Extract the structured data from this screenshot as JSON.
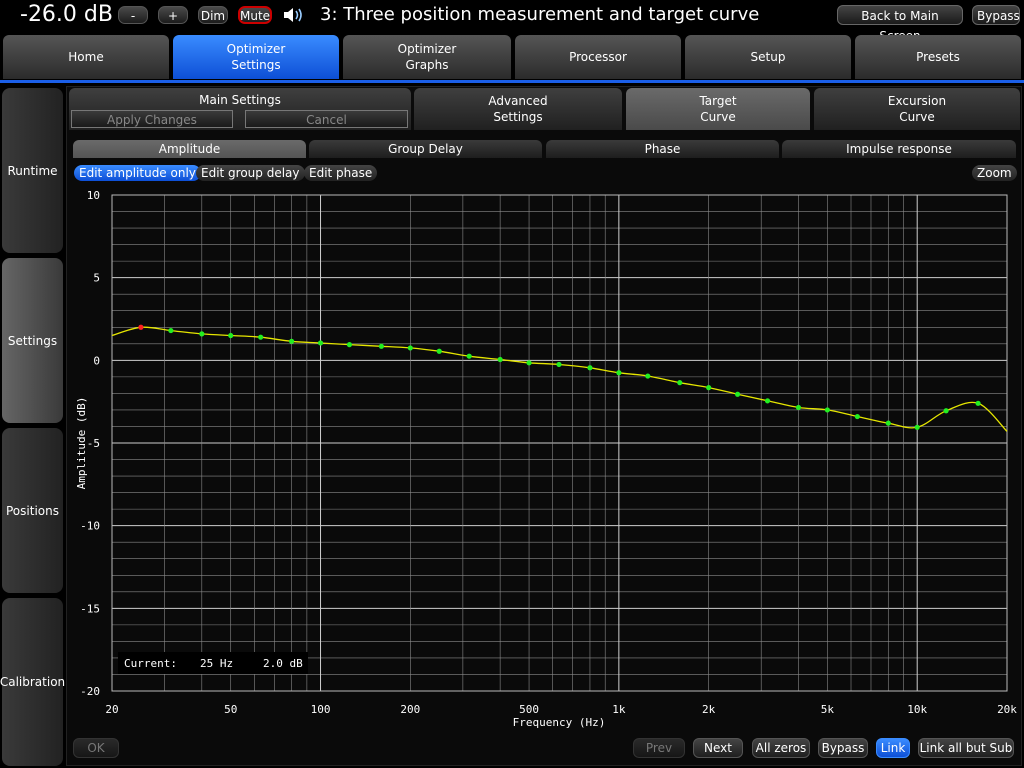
{
  "topbar": {
    "volume": "-26.0 dB",
    "minus": "-",
    "plus": "+",
    "dim": "Dim",
    "mute": "Mute",
    "title": "3: Three position measurement and target curve",
    "back": "Back to Main Screen",
    "bypass": "Bypass"
  },
  "main_tabs": [
    "Home",
    "Optimizer\nSettings",
    "Optimizer\nGraphs",
    "Processor",
    "Setup",
    "Presets"
  ],
  "side_tabs": [
    "Runtime",
    "Settings",
    "Positions",
    "Calibration"
  ],
  "sub_tabs": {
    "main_settings": "Main Settings",
    "apply": "Apply Changes",
    "cancel": "Cancel",
    "advanced": "Advanced\nSettings",
    "target": "Target\nCurve",
    "excursion": "Excursion\nCurve"
  },
  "graph_tabs": [
    "Amplitude",
    "Group Delay",
    "Phase",
    "Impulse response"
  ],
  "edit_pills": [
    "Edit amplitude only",
    "Edit group delay",
    "Edit phase"
  ],
  "zoom": "Zoom",
  "chart_data": {
    "type": "line",
    "xlabel": "Frequency (Hz)",
    "ylabel": "Amplitude (dB)",
    "xscale": "log",
    "xlim": [
      20,
      20000
    ],
    "ylim": [
      -20,
      10
    ],
    "x_ticks": [
      20,
      50,
      100,
      200,
      500,
      1000,
      2000,
      5000,
      10000,
      20000
    ],
    "x_tick_labels": [
      "20",
      "50",
      "100",
      "200",
      "500",
      "1k",
      "2k",
      "5k",
      "10k",
      "20k"
    ],
    "y_ticks": [
      10,
      5,
      0,
      -5,
      -10,
      -15,
      -20
    ],
    "y_tick_labels": [
      "10",
      "5",
      "0",
      "-5",
      "-10",
      "-15",
      "-20"
    ],
    "grid": true,
    "curve_color": "#e6e600",
    "point_color": "#22ee22",
    "selected_point_color": "#ff2222",
    "points": [
      {
        "x": 25,
        "y": 2.0,
        "selected": true
      },
      {
        "x": 31.5,
        "y": 1.8
      },
      {
        "x": 40,
        "y": 1.6
      },
      {
        "x": 50,
        "y": 1.5
      },
      {
        "x": 63,
        "y": 1.4
      },
      {
        "x": 80,
        "y": 1.15
      },
      {
        "x": 100,
        "y": 1.05
      },
      {
        "x": 125,
        "y": 0.95
      },
      {
        "x": 160,
        "y": 0.85
      },
      {
        "x": 200,
        "y": 0.75
      },
      {
        "x": 250,
        "y": 0.55
      },
      {
        "x": 315,
        "y": 0.25
      },
      {
        "x": 400,
        "y": 0.05
      },
      {
        "x": 500,
        "y": -0.15
      },
      {
        "x": 630,
        "y": -0.25
      },
      {
        "x": 800,
        "y": -0.45
      },
      {
        "x": 1000,
        "y": -0.75
      },
      {
        "x": 1250,
        "y": -0.95
      },
      {
        "x": 1600,
        "y": -1.35
      },
      {
        "x": 2000,
        "y": -1.65
      },
      {
        "x": 2500,
        "y": -2.05
      },
      {
        "x": 3150,
        "y": -2.45
      },
      {
        "x": 4000,
        "y": -2.85
      },
      {
        "x": 5000,
        "y": -3.0
      },
      {
        "x": 6300,
        "y": -3.4
      },
      {
        "x": 8000,
        "y": -3.8
      },
      {
        "x": 10000,
        "y": -4.05
      },
      {
        "x": 12500,
        "y": -3.05
      },
      {
        "x": 16000,
        "y": -2.6
      }
    ],
    "curve_start": {
      "x": 20,
      "y": 1.5
    },
    "curve_end": {
      "x": 20000,
      "y": -4.3
    },
    "readout": {
      "label": "Current:",
      "freq": "25 Hz",
      "value": "2.0 dB"
    }
  },
  "bottom": {
    "ok": "OK",
    "prev": "Prev",
    "next": "Next",
    "all_zeros": "All zeros",
    "bypass": "Bypass",
    "link": "Link",
    "link_all": "Link all but Sub"
  }
}
